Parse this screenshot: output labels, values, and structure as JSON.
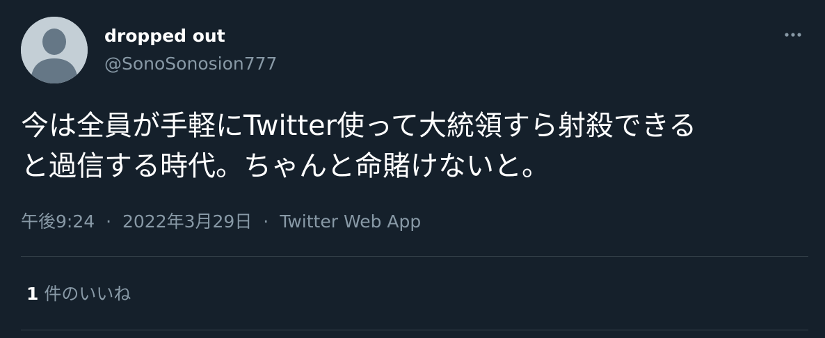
{
  "user": {
    "display_name": "dropped out",
    "handle": "@SonoSonosion777"
  },
  "icons": {
    "avatar": "default-profile-icon",
    "more": "more-horizontal-icon"
  },
  "tweet": {
    "text_line1": "今は全員が手軽にTwitter使って大統領すら射殺できる",
    "text_line2": "と過信する時代。ちゃんと命賭けないと。"
  },
  "meta": {
    "time": "午後9:24",
    "separator": "·",
    "date": "2022年3月29日",
    "source": "Twitter Web App"
  },
  "stats": {
    "like_count": "1",
    "like_label": "件のいいね"
  },
  "colors": {
    "background": "#15202b",
    "primary_text": "#ffffff",
    "secondary_text": "#8899a6",
    "divider": "#38444d",
    "avatar_bg": "#c4cfd6",
    "avatar_figure": "#657786"
  }
}
